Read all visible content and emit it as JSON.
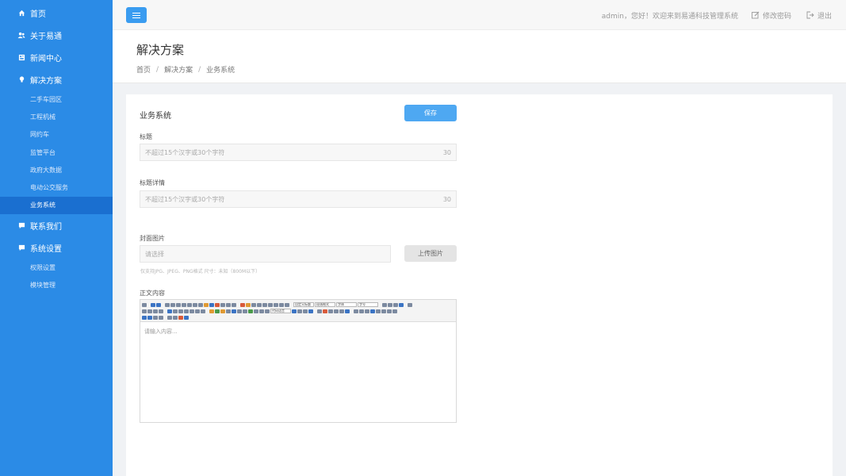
{
  "sidebar": {
    "items": [
      {
        "label": "首页",
        "icon": "home-icon"
      },
      {
        "label": "关于易通",
        "icon": "users-icon"
      },
      {
        "label": "新闻中心",
        "icon": "news-icon"
      },
      {
        "label": "解决方案",
        "icon": "lightbulb-icon"
      },
      {
        "label": "联系我们",
        "icon": "chat-icon"
      },
      {
        "label": "系统设置",
        "icon": "chat-icon"
      }
    ],
    "solutions_sub": [
      "二手车园区",
      "工程机械",
      "网约车",
      "监管平台",
      "政府大数据",
      "电动公交服务",
      "业务系统"
    ],
    "settings_sub": [
      "权限设置",
      "模块管理"
    ],
    "active_sub": "业务系统",
    "colors": {
      "bg": "#2b8be6",
      "active": "#1a6fd0"
    }
  },
  "topbar": {
    "welcome": "admin，您好！欢迎来到易通科技管理系统",
    "change_password": "修改密码",
    "logout": "退出"
  },
  "page": {
    "title": "解决方案",
    "breadcrumb": [
      "首页",
      "解决方案",
      "业务系统"
    ],
    "breadcrumb_sep": "/"
  },
  "form": {
    "section_title": "业务系统",
    "save_label": "保存",
    "title_label": "标题",
    "title_placeholder": "不超过15个汉字或30个字符",
    "title_count": "30",
    "detail_label": "标题详情",
    "detail_placeholder": "不超过15个汉字或30个字符",
    "detail_count": "30",
    "cover_label": "封面图片",
    "cover_placeholder": "请选择",
    "upload_label": "上传图片",
    "cover_hint": "仅支持JPG、JPEG、PNG格式 尺寸：未知（800M以下）",
    "content_label": "正文内容",
    "editor_placeholder": "请输入内容...",
    "toolbar_selects": [
      "自定义标题",
      "段落格式",
      "字体",
      "字号",
      "代码语言"
    ]
  }
}
